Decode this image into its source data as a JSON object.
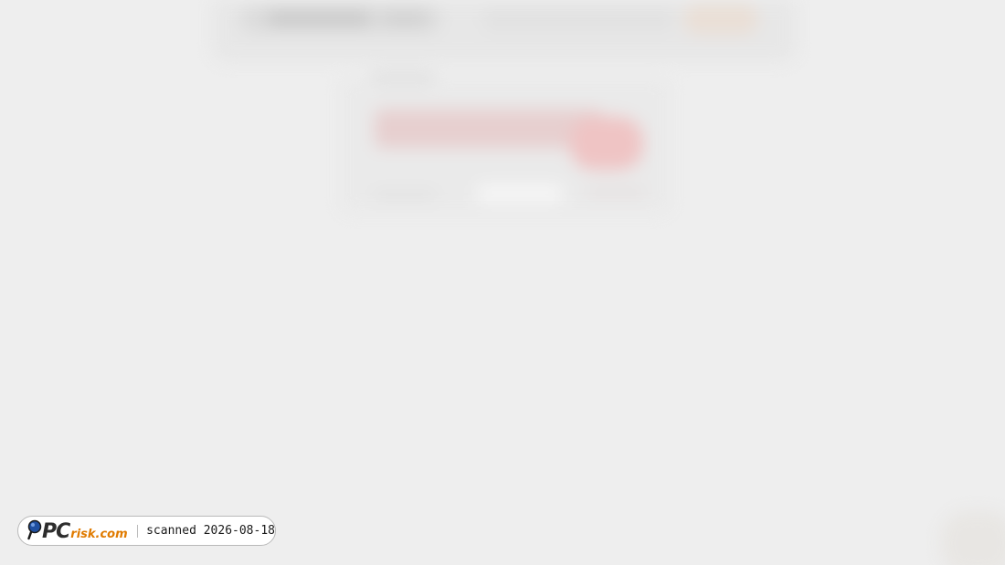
{
  "badge": {
    "logo_main": "PC",
    "logo_domain": "risk.com",
    "scan_text": "scanned 2026-08-18",
    "colors": {
      "logo_main": "#2d2d2d",
      "logo_domain": "#e07b00",
      "magnifier": "#1f4fa0"
    }
  },
  "background": {
    "color": "#eeeeee",
    "blurred": true,
    "accent": "#efc4c4"
  }
}
